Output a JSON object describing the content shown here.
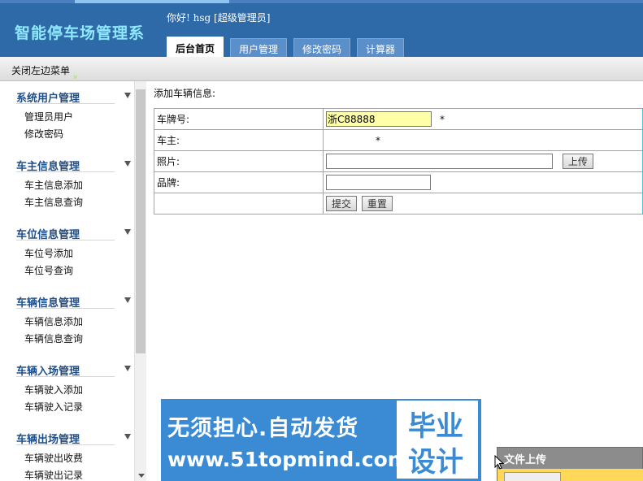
{
  "header": {
    "app_title": "智能停车场管理系",
    "greeting": "你好! hsg [超级管理员]",
    "tabs": [
      {
        "label": "后台首页",
        "active": true
      },
      {
        "label": "用户管理",
        "active": false
      },
      {
        "label": "修改密码",
        "active": false
      },
      {
        "label": "计算器",
        "active": false
      }
    ]
  },
  "toolbar": {
    "close_menu_label": "关闭左边菜单",
    "badge": "v"
  },
  "sidebar": {
    "groups": [
      {
        "title": "系统用户管理",
        "items": [
          "管理员用户",
          "修改密码"
        ]
      },
      {
        "title": "车主信息管理",
        "items": [
          "车主信息添加",
          "车主信息查询"
        ]
      },
      {
        "title": "车位信息管理",
        "items": [
          "车位号添加",
          "车位号查询"
        ]
      },
      {
        "title": "车辆信息管理",
        "items": [
          "车辆信息添加",
          "车辆信息查询"
        ]
      },
      {
        "title": "车辆入场管理",
        "items": [
          "车辆驶入添加",
          "车辆驶入记录"
        ]
      },
      {
        "title": "车辆出场管理",
        "items": [
          "车辆驶出收费",
          "车辆驶出记录"
        ]
      }
    ]
  },
  "form": {
    "heading": "添加车辆信息:",
    "plate_label": "车牌号:",
    "plate_value": "浙C88888",
    "owner_label": "车主:",
    "photo_label": "照片:",
    "brand_label": "品牌:",
    "required_mark": "*",
    "upload_button": "上传",
    "submit_button": "提交",
    "reset_button": "重置"
  },
  "banner": {
    "line1": "无须担心.自动发货",
    "line2": "www.51topmind.com",
    "box_line1": "毕业",
    "box_line2": "设计"
  },
  "upload_popup": {
    "title": "文件上传"
  },
  "colors": {
    "header_bg": "#2f6aa8",
    "title_color": "#8ee8ff",
    "sidebar_group_title": "#1f4f8a",
    "table_border": "#44c8dc",
    "plate_input_bg": "#ffffa8",
    "banner_bg": "#3b8ad4"
  }
}
